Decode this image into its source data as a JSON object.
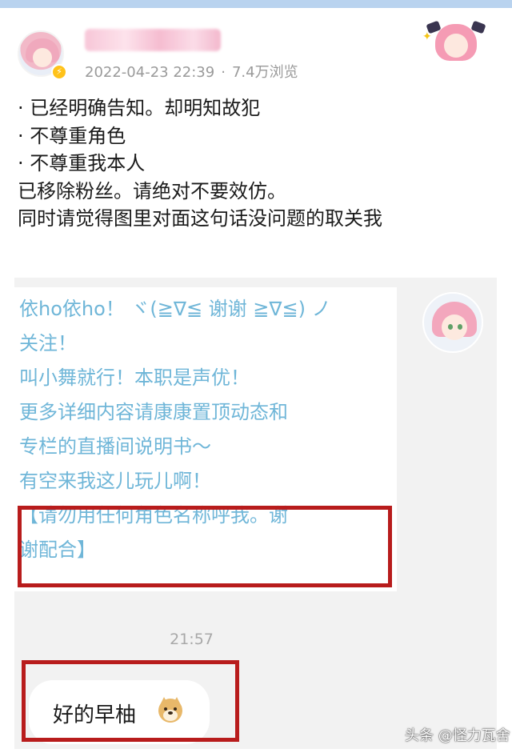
{
  "header": {
    "username": "",
    "date": "2022-04-23 22:39",
    "separator": "·",
    "views": "7.4万浏览",
    "verified_icon": "lightning-badge-icon"
  },
  "post": {
    "lines": [
      "· 已经明确告知。却明知故犯",
      "· 不尊重角色",
      "· 不尊重我本人",
      "已移除粉丝。请绝对不要效仿。",
      "同时请觉得图里对面这句话没问题的取关我"
    ]
  },
  "chat": {
    "incoming": {
      "lines": [
        "依ho依ho！ ヾ(≧∇≦ 谢谢 ≧∇≦) ノ",
        "关注！",
        "叫小舞就行！本职是声优！",
        "更多详细内容请康康置顶动态和",
        "专栏的直播间说明书～",
        "有空来我这儿玩儿啊！",
        "【请勿用任何角色名称呼我。谢",
        "谢配合】"
      ],
      "text_color": "#6fb6d8"
    },
    "timestamp": "21:57",
    "outgoing": {
      "text": "好的早柚",
      "emoji": "doge-emoji-icon"
    },
    "highlight_color": "#b81c1c"
  },
  "watermark": "头条 @怪力瓦舍"
}
